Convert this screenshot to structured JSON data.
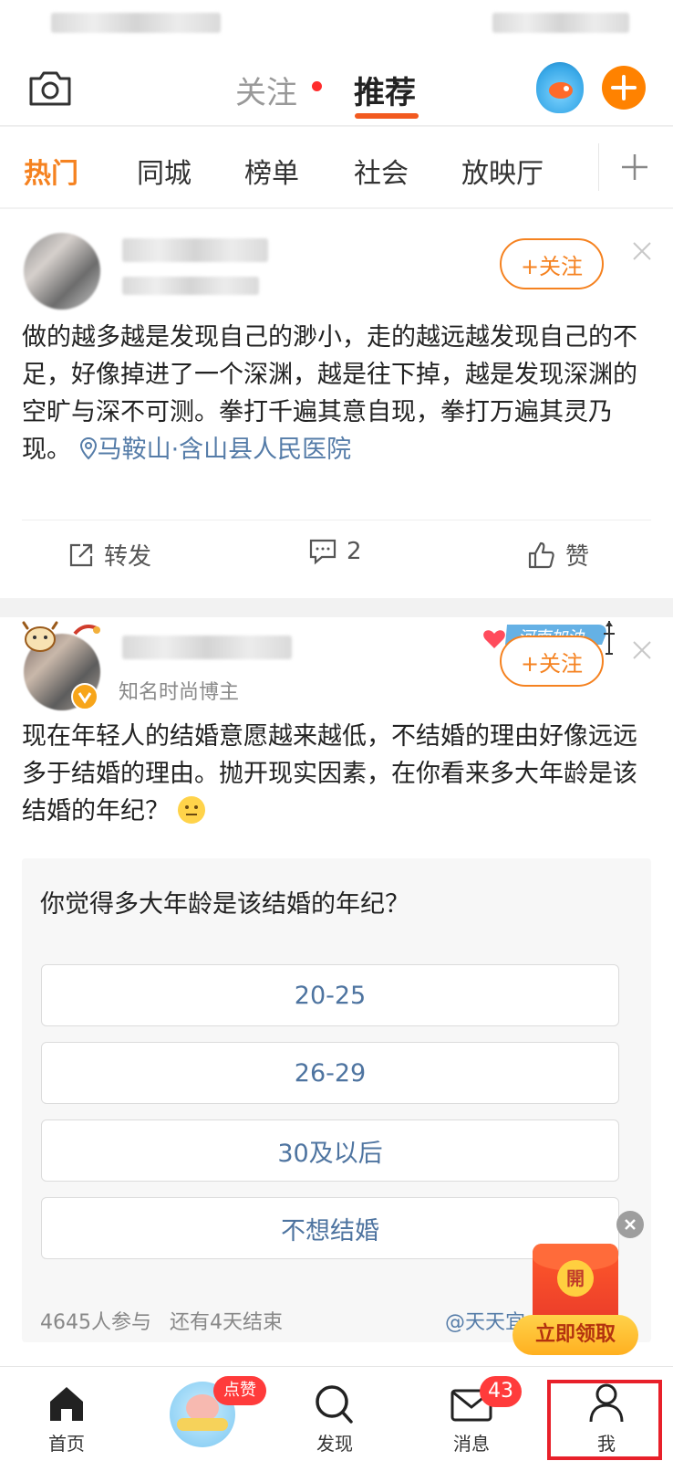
{
  "header": {
    "tabs": [
      {
        "label": "关注",
        "has_dot": true
      },
      {
        "label": "推荐",
        "active": true
      }
    ]
  },
  "categories": {
    "items": [
      "热门",
      "同城",
      "榜单",
      "社会",
      "放映厅"
    ],
    "active": "热门",
    "add_icon": "plus-icon"
  },
  "post1": {
    "follow_label": "+关注",
    "text": "做的越多越是发现自己的渺小，走的越远越发现自己的不足，好像掉进了一个深渊，越是往下掉，越是发现深渊的空旷与深不可测。拳打千遍其意自现，拳打万遍其灵乃现。",
    "location": "马鞍山·含山县人民医院",
    "actions": {
      "repost_label": "转发",
      "comment_count": "2",
      "like_label": "赞"
    }
  },
  "post2": {
    "author_tag": "知名时尚博主",
    "follow_label": "+关注",
    "decoration_text": "河南加油",
    "text": "现在年轻人的结婚意愿越来越低，不结婚的理由好像远远多于结婚的理由。抛开现实因素，在你看来多大年龄是该结婚的年纪？",
    "poll": {
      "question": "你觉得多大年龄是该结婚的年纪？",
      "options": [
        "20-25",
        "26-29",
        "30及以后",
        "不想结婚"
      ],
      "participants": "4645人参与",
      "remaining": "还有4天结束",
      "source": "@天天宜"
    }
  },
  "promo": {
    "envelope_char": "開",
    "button_label": "立即领取"
  },
  "bottom_nav": {
    "items": [
      {
        "label": "首页",
        "icon": "home-icon"
      },
      {
        "label": "",
        "icon": "mascot-icon",
        "badge": "点赞"
      },
      {
        "label": "发现",
        "icon": "search-icon"
      },
      {
        "label": "消息",
        "icon": "mail-icon",
        "badge": "43"
      },
      {
        "label": "我",
        "icon": "profile-icon"
      }
    ]
  },
  "colors": {
    "accent_orange": "#f58220",
    "brand_orange": "#ff8200",
    "link_blue": "#557ca8",
    "highlight_red": "#e8202a"
  }
}
